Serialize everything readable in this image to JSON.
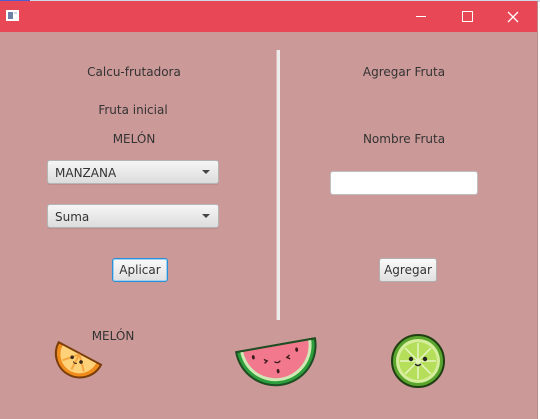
{
  "window": {
    "title": ""
  },
  "left_panel": {
    "heading": "Calcu-frutadora",
    "initial_fruit_label": "Fruta inicial",
    "initial_fruit_value": "MELÓN",
    "fruit_combo": {
      "selected": "MANZANA"
    },
    "operation_combo": {
      "selected": "Suma"
    },
    "apply_button": "Aplicar"
  },
  "right_panel": {
    "heading": "Agregar Fruta",
    "name_label": "Nombre Fruta",
    "name_field": {
      "value": ""
    },
    "add_button": "Agregar"
  },
  "result": {
    "fruit_label": "MELÓN"
  },
  "colors": {
    "titlebar": "#e84855",
    "background": "#cc9999",
    "focus_border": "#2b8fd6"
  },
  "images": [
    "orange-slice-icon",
    "watermelon-slice-icon",
    "lime-slice-icon"
  ]
}
